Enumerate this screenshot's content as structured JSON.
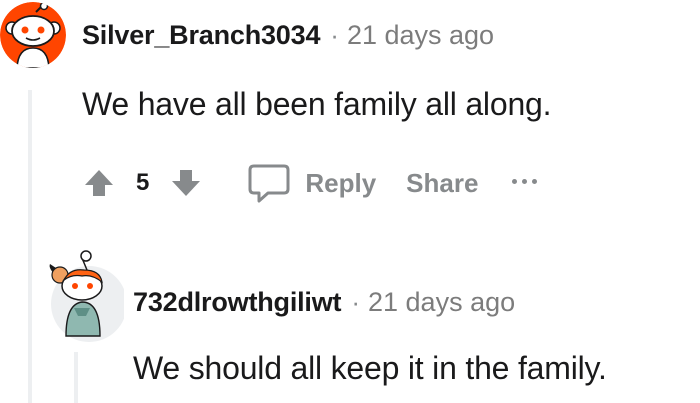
{
  "comments": [
    {
      "username": "Silver_Branch3034",
      "separator": "·",
      "time": "21 days ago",
      "body": "We have all been family all along.",
      "score": "5",
      "actions": {
        "reply": "Reply",
        "share": "Share"
      },
      "avatar_icon": "snoo-avatar-icon"
    },
    {
      "username": "732dlrowthgiliwt",
      "separator": "·",
      "time": "21 days ago",
      "body": "We should all keep it in the family.",
      "avatar_icon": "snoo-avatar-icon"
    }
  ],
  "colors": {
    "brand_orange": "#ff4500",
    "meta_gray": "#7c7c7c",
    "action_gray": "#878a8c",
    "thread_line": "#edeff1"
  }
}
